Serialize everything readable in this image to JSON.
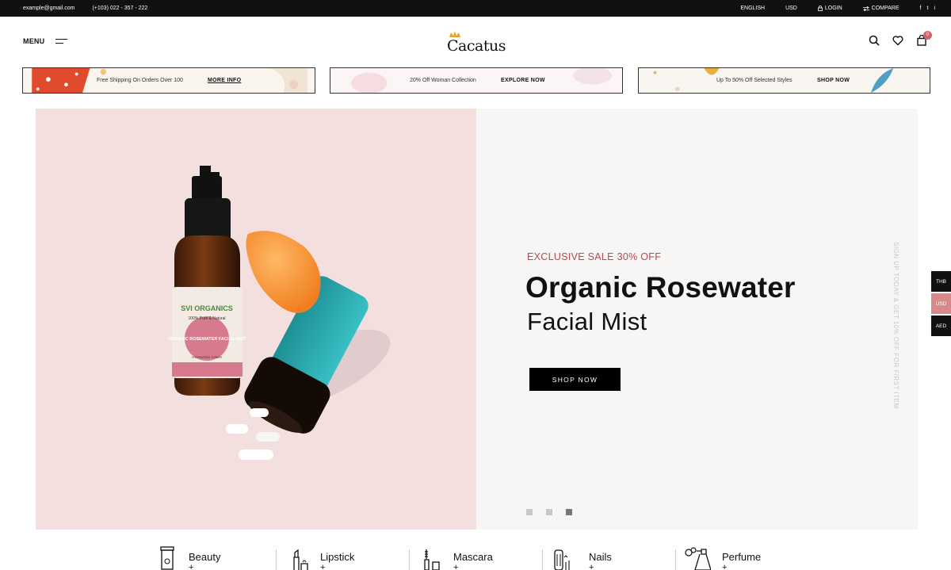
{
  "topbar": {
    "email": "example@gmail.com",
    "phone": "(+103) 022 - 357 - 222",
    "language": "ENGLISH",
    "currency": "USD",
    "login": "LOGIN",
    "compare": "COMPARE",
    "socials": [
      "f",
      "t",
      "i"
    ]
  },
  "header": {
    "menu_label": "MENU",
    "logo_text": "Cacatus",
    "cart_count": "0"
  },
  "promos": [
    {
      "text": "Free Shipping On Orders Over 100",
      "link": "MORE INFO"
    },
    {
      "text": "20% Off Woman Collection",
      "link": "EXPLORE NOW"
    },
    {
      "text": "Up To 50% Off Selected Styles",
      "link": "SHOP NOW"
    }
  ],
  "hero": {
    "kicker": "EXCLUSIVE SALE 30% OFF",
    "title_line1": "Organic Rosewater",
    "title_line2": "Facial Mist",
    "button": "SHOP NOW",
    "side_text": "SIGN UP TODAY & GET 10% OFF FOR FIRST ITEM",
    "slides_total": 3,
    "active_slide": 3,
    "product_label_brand": "SVI ORGANICS",
    "product_label_sub": "100% Pure & Natural",
    "product_label_name": "ORGANIC ROSEWATER FACIAL MIST",
    "product_label_type": "HYDRATING TONER"
  },
  "currency_switcher": [
    "THB",
    "USD",
    "AED"
  ],
  "categories": [
    {
      "label": "Beauty",
      "plus": "+",
      "icon": "beauty-icon"
    },
    {
      "label": "Lipstick",
      "plus": "+",
      "icon": "lipstick-icon"
    },
    {
      "label": "Mascara",
      "plus": "+",
      "icon": "mascara-icon"
    },
    {
      "label": "Nails",
      "plus": "+",
      "icon": "nails-icon"
    },
    {
      "label": "Perfume",
      "plus": "+",
      "icon": "perfume-icon"
    }
  ],
  "colors": {
    "accent": "#b4494f",
    "hero_left": "#f4dfdf",
    "hero_right": "#f8f5f5",
    "currency_active": "#d68a8a",
    "topbar": "#111111"
  }
}
